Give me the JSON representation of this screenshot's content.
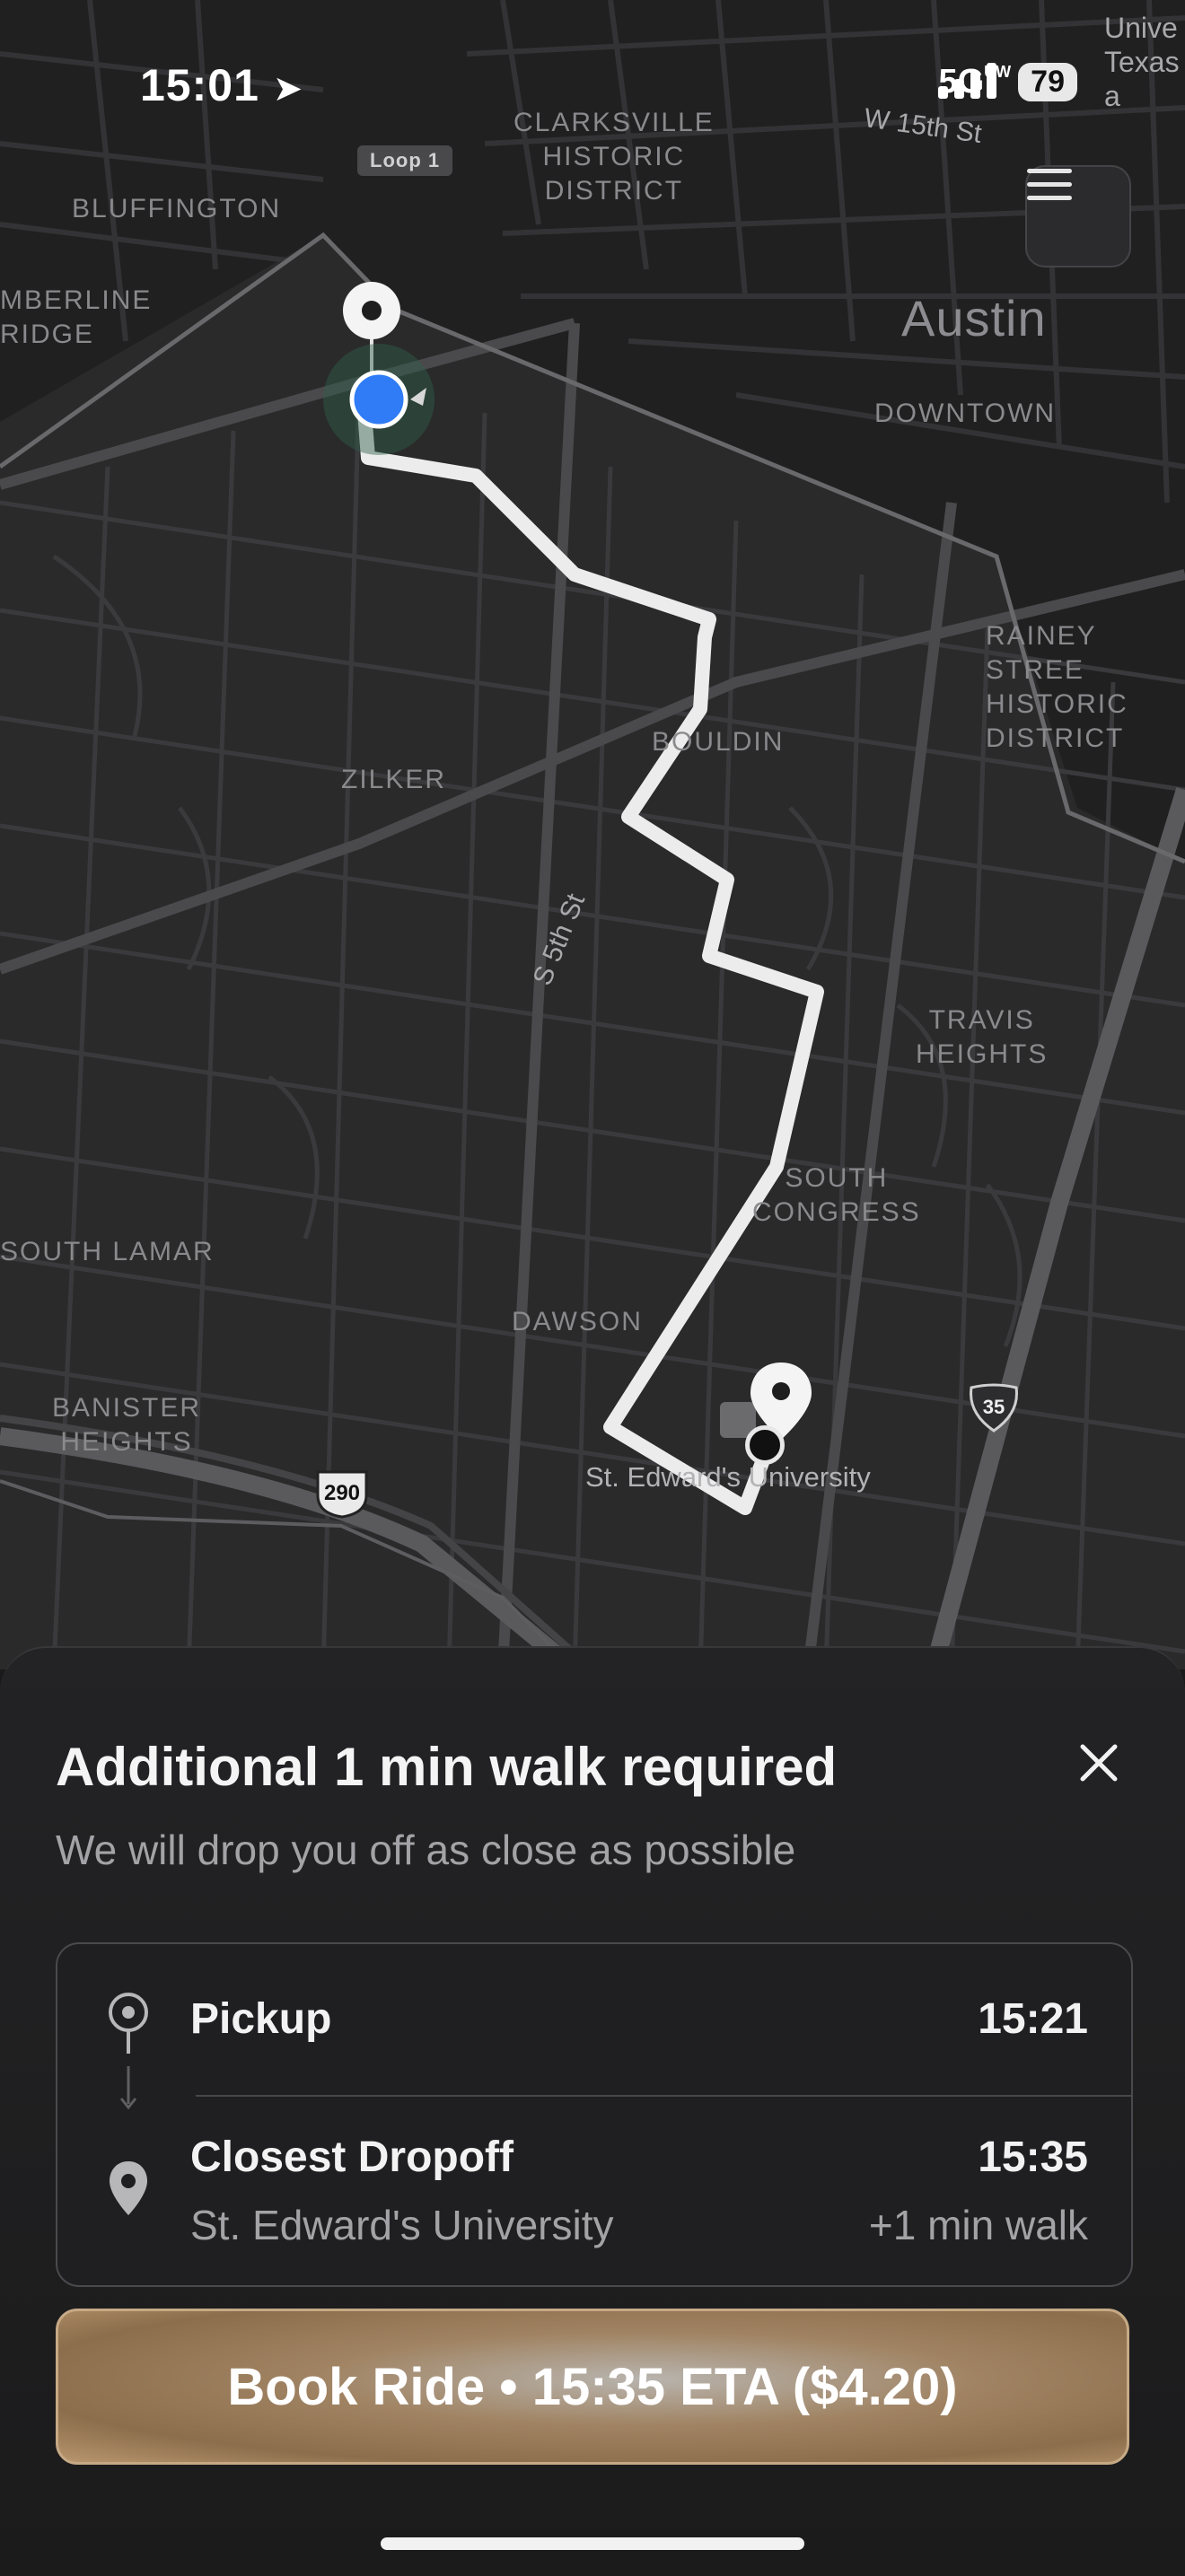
{
  "status_bar": {
    "time": "15:01",
    "network": "5G",
    "network_suffix": "UW",
    "battery": "79"
  },
  "map": {
    "labels": {
      "university_corner": "Unive\nTexas a",
      "clarksville": "CLARKSVILLE\nHISTORIC\nDISTRICT",
      "loop1": "Loop 1",
      "w15th": "W 15th St",
      "bluffington": "BLUFFINGTON",
      "timberline": "MBERLINE\nRIDGE",
      "austin": "Austin",
      "downtown": "DOWNTOWN",
      "rainey": "RAINEY STREE\nHISTORIC\nDISTRICT",
      "bouldin": "BOULDIN",
      "zilker": "ZILKER",
      "s5th": "S 5th St",
      "travis": "TRAVIS\nHEIGHTS",
      "south_congress": "SOUTH\nCONGRESS",
      "south_lamar": "SOUTH LAMAR",
      "dawson": "DAWSON",
      "banister": "BANISTER\nHEIGHTS",
      "hwy290": "290",
      "i35": "35",
      "st_edwards": "St. Edward's University"
    }
  },
  "sheet": {
    "title": "Additional 1 min walk required",
    "subtitle": "We will drop you off as close as possible",
    "pickup_label": "Pickup",
    "pickup_time": "15:21",
    "dropoff_label": "Closest Dropoff",
    "dropoff_time": "15:35",
    "dropoff_place": "St. Edward's University",
    "walk_note": "+1 min walk",
    "book_button": "Book Ride • 15:35 ETA ($4.20)"
  },
  "colors": {
    "accent_location": "#2f7cf6",
    "route": "#f2f2f2",
    "button_gold": "#a08362"
  },
  "icons": [
    "location-arrow-icon",
    "signal-icon",
    "menu-icon",
    "close-icon",
    "pickup-pin-icon",
    "dropoff-pin-icon",
    "current-location-icon",
    "school-icon"
  ]
}
